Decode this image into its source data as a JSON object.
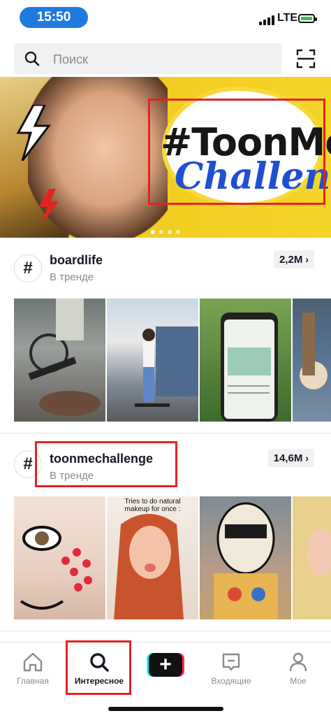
{
  "status_bar": {
    "time": "15:50",
    "network": "LTE"
  },
  "search": {
    "placeholder": "Поиск"
  },
  "banner": {
    "headline": "#ToonMe",
    "subline": "Challenge",
    "slide_count": 4,
    "active_slide": 0
  },
  "sections": [
    {
      "tag": "boardlife",
      "status": "В тренде",
      "count": "2,2M",
      "thumbnails": [
        "skateboard-legs",
        "girl-longboard",
        "phone-screen",
        "wheel-closeup"
      ]
    },
    {
      "tag": "toonmechallenge",
      "status": "В тренде",
      "count": "14,6M",
      "thumbnails": [
        "comic-makeup-eye",
        "natural-makeup",
        "cartoon-face-paint",
        "blonde-closeup"
      ],
      "caption": "Tries to do natural makeup for once :"
    }
  ],
  "bottom_nav": [
    {
      "label": "Главная",
      "icon": "home-icon"
    },
    {
      "label": "Интересное",
      "icon": "search-icon",
      "active": true
    },
    {
      "label": "",
      "icon": "plus-icon"
    },
    {
      "label": "Входящие",
      "icon": "inbox-icon"
    },
    {
      "label": "Мое",
      "icon": "profile-icon"
    }
  ],
  "colors": {
    "accent_time": "#1f7ae0",
    "highlight_red": "#e52222",
    "tiktok_cyan": "#25f4ee",
    "tiktok_pink": "#fe2c55"
  }
}
